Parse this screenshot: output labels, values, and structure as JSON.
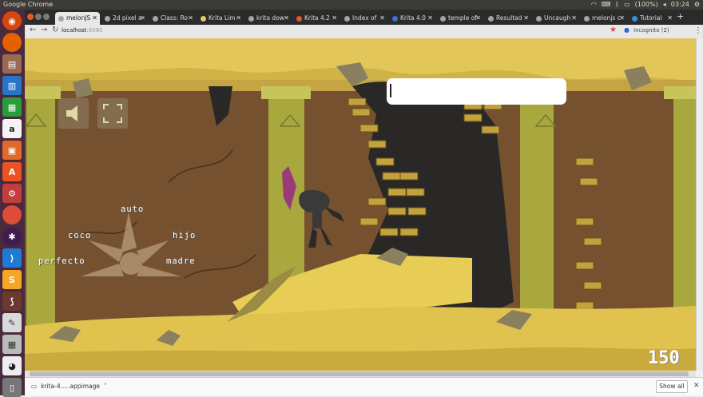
{
  "system": {
    "app_title": "Google Chrome",
    "battery": "(100%)",
    "time": "03:24"
  },
  "tabs": [
    {
      "label": "melonJS"
    },
    {
      "label": "2d pixel a"
    },
    {
      "label": "Class: Ro"
    },
    {
      "label": "Krita Lim"
    },
    {
      "label": "krita dow"
    },
    {
      "label": "Krita 4.2"
    },
    {
      "label": "Index of"
    },
    {
      "label": "Krita 4.0"
    },
    {
      "label": "temple of"
    },
    {
      "label": "Resultad"
    },
    {
      "label": "Uncaugh"
    },
    {
      "label": "melonjs c"
    },
    {
      "label": "Tutorial"
    }
  ],
  "toolbar": {
    "url_host": "localhost",
    "url_port": ":8080",
    "incognito": "Incognito (2)"
  },
  "game": {
    "options": {
      "top": "auto",
      "left": "coco",
      "right": "hijo",
      "bottom_left": "perfecto",
      "bottom_right": "madre"
    },
    "score": "150"
  },
  "download": {
    "filename": "krita-4.....appimage",
    "show_all": "Show all"
  }
}
